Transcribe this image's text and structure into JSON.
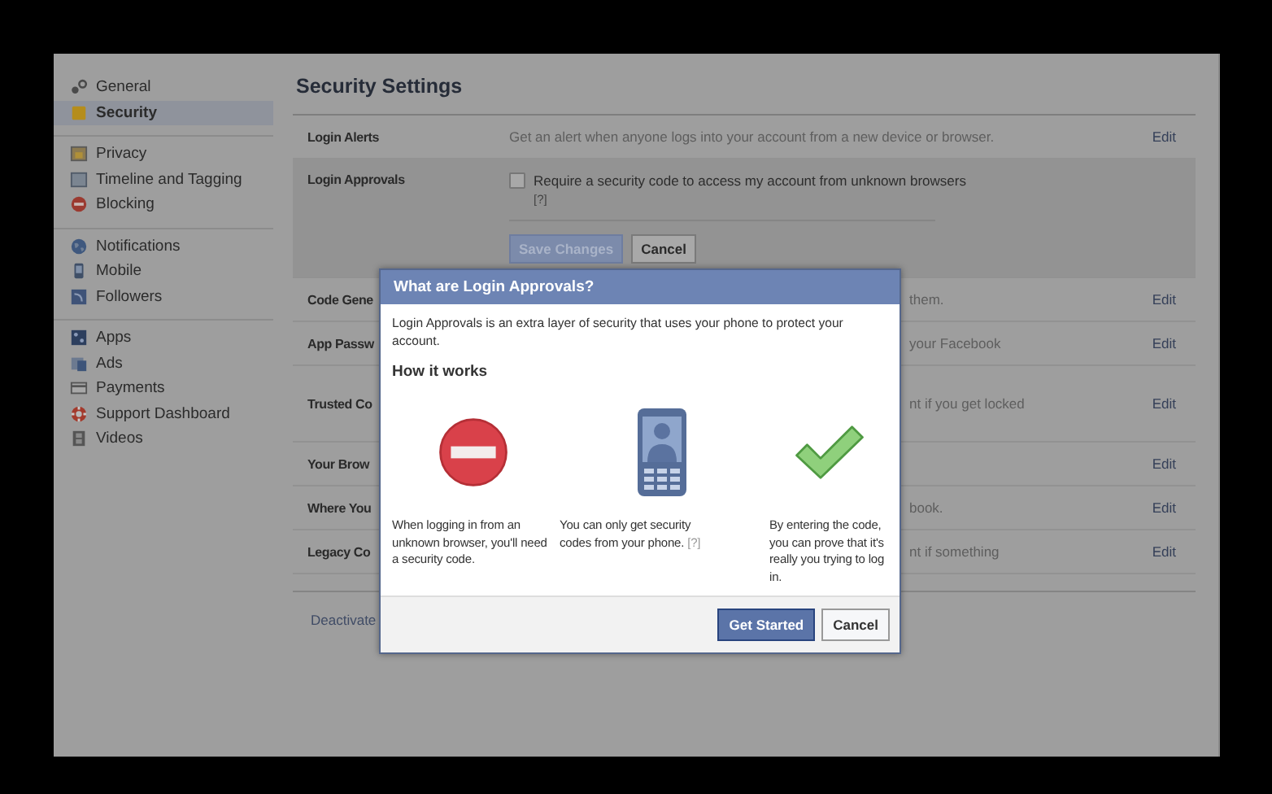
{
  "sidebar": {
    "groups": [
      {
        "items": [
          {
            "label": "General",
            "selected": false
          },
          {
            "label": "Security",
            "selected": true
          }
        ]
      },
      {
        "items": [
          {
            "label": "Privacy",
            "selected": false
          },
          {
            "label": "Timeline and Tagging",
            "selected": false
          },
          {
            "label": "Blocking",
            "selected": false
          }
        ]
      },
      {
        "items": [
          {
            "label": "Notifications",
            "selected": false
          },
          {
            "label": "Mobile",
            "selected": false
          },
          {
            "label": "Followers",
            "selected": false
          }
        ]
      },
      {
        "items": [
          {
            "label": "Apps",
            "selected": false
          },
          {
            "label": "Ads",
            "selected": false
          },
          {
            "label": "Payments",
            "selected": false
          },
          {
            "label": "Support Dashboard",
            "selected": false
          },
          {
            "label": "Videos",
            "selected": false
          }
        ]
      }
    ]
  },
  "main": {
    "title": "Security Settings",
    "rows": [
      {
        "kind": "full",
        "label": "Login Alerts",
        "description": "Get an alert when anyone logs into your account from a new device or browser.",
        "action": "Edit"
      },
      {
        "kind": "expanded",
        "label": "Login Approvals",
        "option": "Require a security code to access my account from unknown browsers",
        "checked": false,
        "help": "[?]",
        "save": "Save Changes",
        "cancel": "Cancel"
      },
      {
        "kind": "covered",
        "label": "Code Gene",
        "description": "them.",
        "action": "Edit"
      },
      {
        "kind": "covered",
        "label": "App Passw",
        "description": "your Facebook",
        "action": "Edit"
      },
      {
        "kind": "covered",
        "label": "Trusted Co",
        "description": "nt if you get locked",
        "action": "Edit"
      },
      {
        "kind": "covered",
        "label": "Your Brow",
        "action": "Edit"
      },
      {
        "kind": "covered",
        "label": "Where You",
        "description": "book.",
        "action": "Edit"
      },
      {
        "kind": "covered",
        "label": "Legacy Co",
        "description": "nt if something",
        "action": "Edit"
      }
    ],
    "footer_link": "Deactivate"
  },
  "dialog": {
    "title": "What are Login Approvals?",
    "intro": "Login Approvals is an extra layer of security that uses your phone to protect your account.",
    "heading": "How it works",
    "steps": [
      {
        "text": "When logging in from an unknown browser, you'll need a security code."
      },
      {
        "text": "You can only get security codes from your phone.",
        "help": "[?]"
      },
      {
        "text": "By entering the code, you can prove that it's really you trying to log in."
      }
    ],
    "buttons": [
      {
        "label": "Get Started",
        "kind": "primary"
      },
      {
        "label": "Cancel",
        "kind": "secondary"
      }
    ]
  }
}
